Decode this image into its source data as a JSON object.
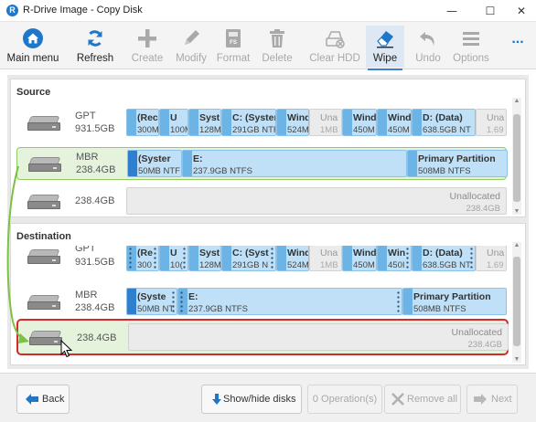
{
  "window": {
    "title": "R-Drive Image - Copy Disk",
    "app_icon": "R",
    "minimize": "—",
    "maximize": "☐",
    "close": "✕"
  },
  "toolbar": {
    "main_menu": "Main menu",
    "refresh": "Refresh",
    "create": "Create",
    "modify": "Modify",
    "format": "Format",
    "delete": "Delete",
    "clear_hdd": "Clear HDD",
    "wipe": "Wipe",
    "undo": "Undo",
    "options": "Options",
    "more": "..."
  },
  "source": {
    "title": "Source",
    "disks": [
      {
        "type": "GPT",
        "size": "931.5GB",
        "partitions": [
          {
            "name": "(Rec",
            "size": "300M"
          },
          {
            "name": "U",
            "size": "100M"
          },
          {
            "name": "Syst",
            "size": "128M"
          },
          {
            "name": "C: (Syster",
            "size": "291GB NTF"
          },
          {
            "name": "Wind",
            "size": "524M"
          },
          {
            "name": "Una",
            "size": "1MB"
          },
          {
            "name": "Wind",
            "size": "450M"
          },
          {
            "name": "Wind",
            "size": "450M"
          },
          {
            "name": "D: (Data)",
            "size": "638.5GB NT"
          },
          {
            "name": "Una",
            "size": "1.69"
          }
        ]
      },
      {
        "type": "MBR",
        "size": "238.4GB",
        "partitions": [
          {
            "name": "(Syster",
            "size": "50MB NTF"
          },
          {
            "name": "E:",
            "size": "237.9GB NTFS"
          },
          {
            "name": "Primary Partition",
            "size": "508MB NTFS"
          }
        ]
      },
      {
        "type": "",
        "size": "238.4GB",
        "partitions": [
          {
            "name": "Unallocated",
            "size": "238.4GB"
          }
        ]
      }
    ]
  },
  "destination": {
    "title": "Destination",
    "disks": [
      {
        "type": "GPT",
        "size": "931.5GB",
        "partitions": [
          {
            "name": "(Re",
            "size": "300"
          },
          {
            "name": "U",
            "size": "10("
          },
          {
            "name": "Syst",
            "size": "128M"
          },
          {
            "name": "C: (Syst",
            "size": "291GB N"
          },
          {
            "name": "Wind",
            "size": "524M"
          },
          {
            "name": "Una",
            "size": "1MB"
          },
          {
            "name": "Wind",
            "size": "450M"
          },
          {
            "name": "Win",
            "size": "450I"
          },
          {
            "name": "D: (Data)",
            "size": "638.5GB NT"
          },
          {
            "name": "Una",
            "size": "1.69"
          }
        ]
      },
      {
        "type": "MBR",
        "size": "238.4GB",
        "partitions": [
          {
            "name": "(Syste",
            "size": "50MB NT"
          },
          {
            "name": "E:",
            "size": "237.9GB NTFS"
          },
          {
            "name": "Primary Partition",
            "size": "508MB NTFS"
          }
        ]
      },
      {
        "type": "",
        "size": "238.4GB",
        "partitions": [
          {
            "name": "Unallocated",
            "size": "238.4GB"
          }
        ]
      }
    ]
  },
  "footer": {
    "back": "Back",
    "show_hide": "Show/hide disks",
    "operations": "0 Operation(s)",
    "remove_all": "Remove all",
    "next": "Next"
  },
  "colors": {
    "accent": "#1e77c8",
    "partition": "#bfe0f6",
    "selected_bg": "#e5f3dc",
    "target_border": "#d42a2a",
    "link_arrow": "#7bc142"
  }
}
